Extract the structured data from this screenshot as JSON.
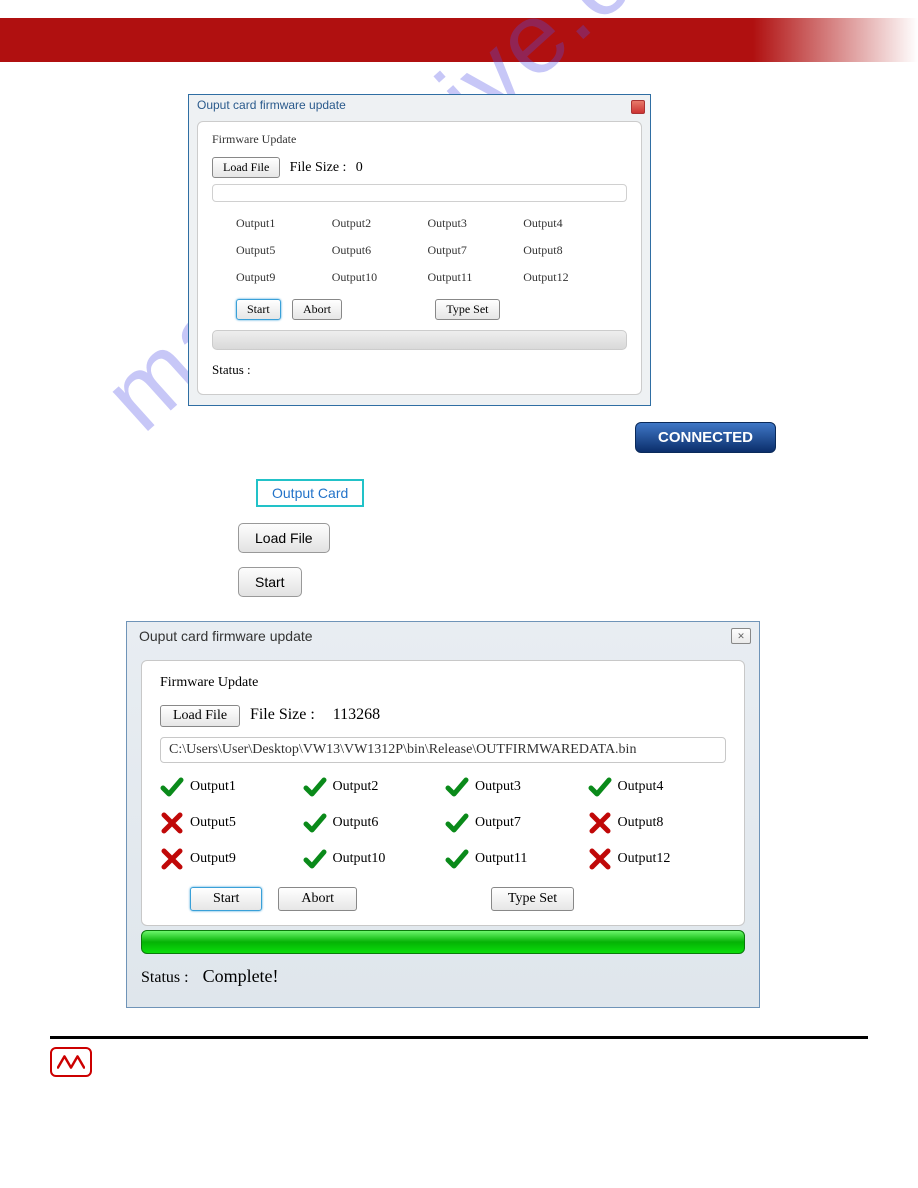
{
  "watermark": "manualshive.com",
  "dlg1": {
    "title": "Ouput card firmware update",
    "group": "Firmware Update",
    "load": "Load File",
    "fs_label": "File Size :",
    "fs_val": "0",
    "outputs": [
      "Output1",
      "Output2",
      "Output3",
      "Output4",
      "Output5",
      "Output6",
      "Output7",
      "Output8",
      "Output9",
      "Output10",
      "Output11",
      "Output12"
    ],
    "start": "Start",
    "abort": "Abort",
    "typeset": "Type Set",
    "status_label": "Status :"
  },
  "connected": "CONNECTED",
  "outcard": "Output Card",
  "loadfile_mid": "Load File",
  "start_mid": "Start",
  "dlg2": {
    "title": "Ouput card firmware update",
    "group": "Firmware Update",
    "load": "Load File",
    "fs_label": "File Size :",
    "fs_val": "113268",
    "path": "C:\\Users\\User\\Desktop\\VW13\\VW1312P\\bin\\Release\\OUTFIRMWAREDATA.bin",
    "outputs": [
      {
        "label": "Output1",
        "ok": true
      },
      {
        "label": "Output2",
        "ok": true
      },
      {
        "label": "Output3",
        "ok": true
      },
      {
        "label": "Output4",
        "ok": true
      },
      {
        "label": "Output5",
        "ok": false
      },
      {
        "label": "Output6",
        "ok": true
      },
      {
        "label": "Output7",
        "ok": true
      },
      {
        "label": "Output8",
        "ok": false
      },
      {
        "label": "Output9",
        "ok": false
      },
      {
        "label": "Output10",
        "ok": true
      },
      {
        "label": "Output11",
        "ok": true
      },
      {
        "label": "Output12",
        "ok": false
      }
    ],
    "start": "Start",
    "abort": "Abort",
    "typeset": "Type Set",
    "status_label": "Status :",
    "status_val": "Complete!"
  }
}
